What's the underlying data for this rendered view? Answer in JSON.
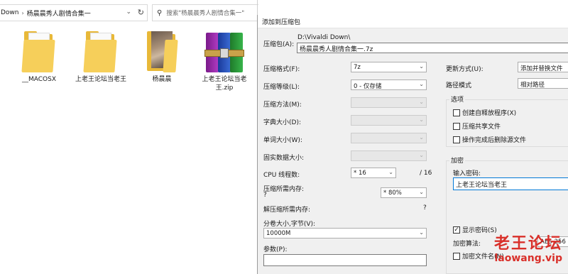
{
  "explorer": {
    "breadcrumb": [
      "Down",
      "杨晨晨秀人剧情合集一"
    ],
    "search_placeholder": "搜索\"杨晨晨秀人剧情合集一\"",
    "files": [
      {
        "name": "__MACOSX",
        "type": "folder"
      },
      {
        "name": "上老王论坛当老王",
        "type": "folder"
      },
      {
        "name": "杨晨晨",
        "type": "folder-photo"
      },
      {
        "name": "上老王论坛当老王.zip",
        "type": "archive"
      }
    ]
  },
  "dialog": {
    "title": "添加到压缩包",
    "archive_label": "压缩包(A):",
    "archive_dir": "D:\\Vivaldi Down\\",
    "archive_name": "杨晨晨秀人剧情合集一.7z",
    "format_label": "压缩格式(F):",
    "format_value": "7z",
    "level_label": "压缩等级(L):",
    "level_value": "0 - 仅存储",
    "method_label": "压缩方法(M):",
    "dict_label": "字典大小(D):",
    "word_label": "单词大小(W):",
    "solid_label": "固实数据大小:",
    "threads_label": "CPU 线程数:",
    "threads_value": "* 16",
    "threads_total": "/ 16",
    "mem_compress_label": "压缩所需内存:",
    "mem_compress_q": "?",
    "mem_value": "* 80%",
    "mem_decompress_label": "解压缩所需内存:",
    "mem_decompress_q": "?",
    "split_label": "分卷大小,字节(V):",
    "split_value": "10000M",
    "params_label": "参数(P):",
    "update_label": "更新方式(U):",
    "update_value": "添加并替换文件",
    "path_label": "路径模式",
    "path_value": "相对路径",
    "options_title": "选项",
    "opt_sfx": "创建自释放程序(X)",
    "opt_shared": "压缩共享文件",
    "opt_delete": "操作完成后删除源文件",
    "encrypt_title": "加密",
    "password_label": "输入密码:",
    "password_value": "上老王论坛当老王",
    "show_password": "显示密码(S)",
    "encrypt_method_label": "加密算法:",
    "encrypt_method_value": "AES-256",
    "encrypt_names": "加密文件名(N)"
  },
  "watermark": {
    "line1": "老王论坛",
    "line2": "laowang.vip"
  }
}
